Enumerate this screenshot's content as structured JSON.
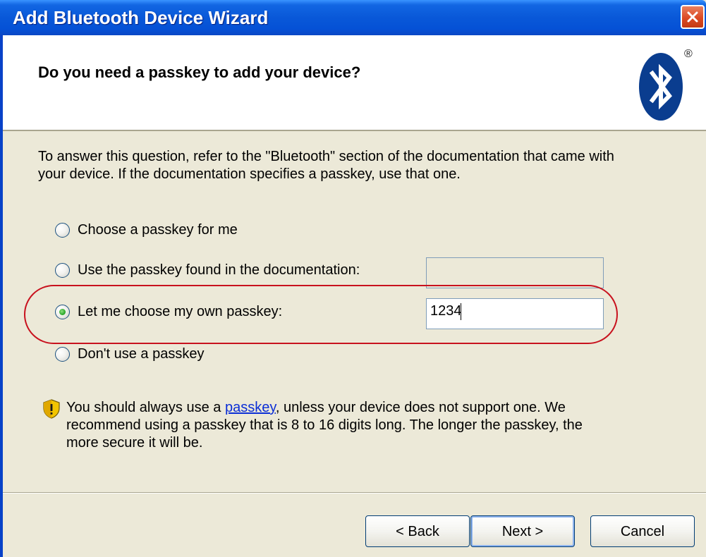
{
  "window": {
    "title": "Add Bluetooth Device Wizard",
    "close_icon": "close-icon"
  },
  "header": {
    "title": "Do you need a passkey to add your device?",
    "logo_icon": "bluetooth-logo-icon",
    "registered_mark": "®"
  },
  "intro": {
    "line1": "To answer this question, refer to the \"Bluetooth\" section of the documentation that came with",
    "line2": "your device. If the documentation specifies a passkey, use that one."
  },
  "options": [
    {
      "label": "Choose a passkey for me",
      "selected": false
    },
    {
      "label": "Use the passkey found in the documentation:",
      "selected": false
    },
    {
      "label": "Let me choose my own passkey:",
      "selected": true
    },
    {
      "label": "Don't use a passkey",
      "selected": false
    }
  ],
  "fields": {
    "documentation_passkey": "",
    "own_passkey": "1234"
  },
  "warning": {
    "icon": "security-shield-icon",
    "prefix": "You should always use a ",
    "link": "passkey",
    "line1_rest": ", unless your device does not support one. We",
    "line2": "recommend using a passkey that is 8 to 16 digits long. The longer the passkey, the",
    "line3": "more secure it will be."
  },
  "buttons": {
    "back": "< Back",
    "next": "Next >",
    "cancel": "Cancel"
  },
  "colors": {
    "titlebar": "#0958d8",
    "dialog_bg": "#ece9d8",
    "highlight": "#c8121e",
    "radio_selected": "#21a121",
    "bluetooth_blue": "#0a3d8f"
  }
}
